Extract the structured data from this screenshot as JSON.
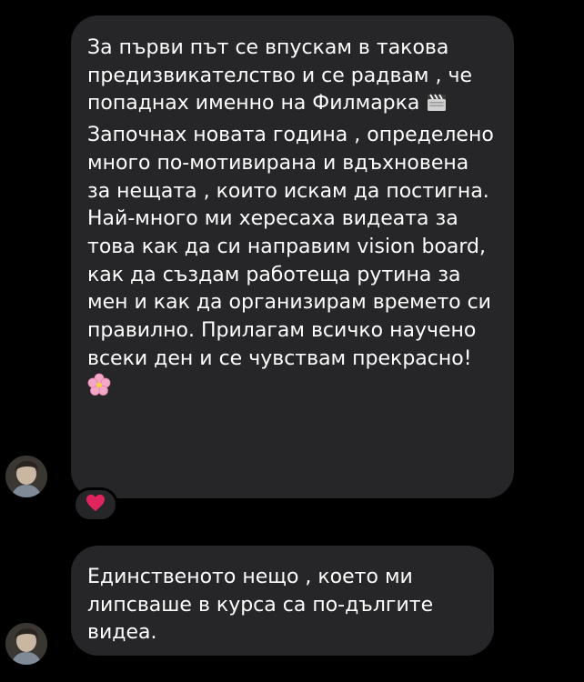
{
  "messages": [
    {
      "text": "За първи път се впускам в такова предизвикателство и се радвам , че попаднах именно на Филмарка",
      "text_continued": "Започнах новата година , определено много по-мотивирана и вдъхновена за нещата , които искам да постигна. Най-много ми хересаха видеата за това как да си направим vision board, как да създам работеща рутина за мен и как да организирам времето си правилно. Прилагам всичко научено всеки ден и се чувствам прекрасно!",
      "emoji_inline": "clapper-board-icon",
      "emoji_end": "cherry-blossom-icon",
      "reaction": "heart-icon",
      "reaction_color": "#e0245e"
    },
    {
      "text": "Единственото нещо , което ми липсваше в курса са по-дългите видеа."
    }
  ],
  "theme": {
    "background": "#000000",
    "bubble": "#262628",
    "text": "#ffffff"
  }
}
